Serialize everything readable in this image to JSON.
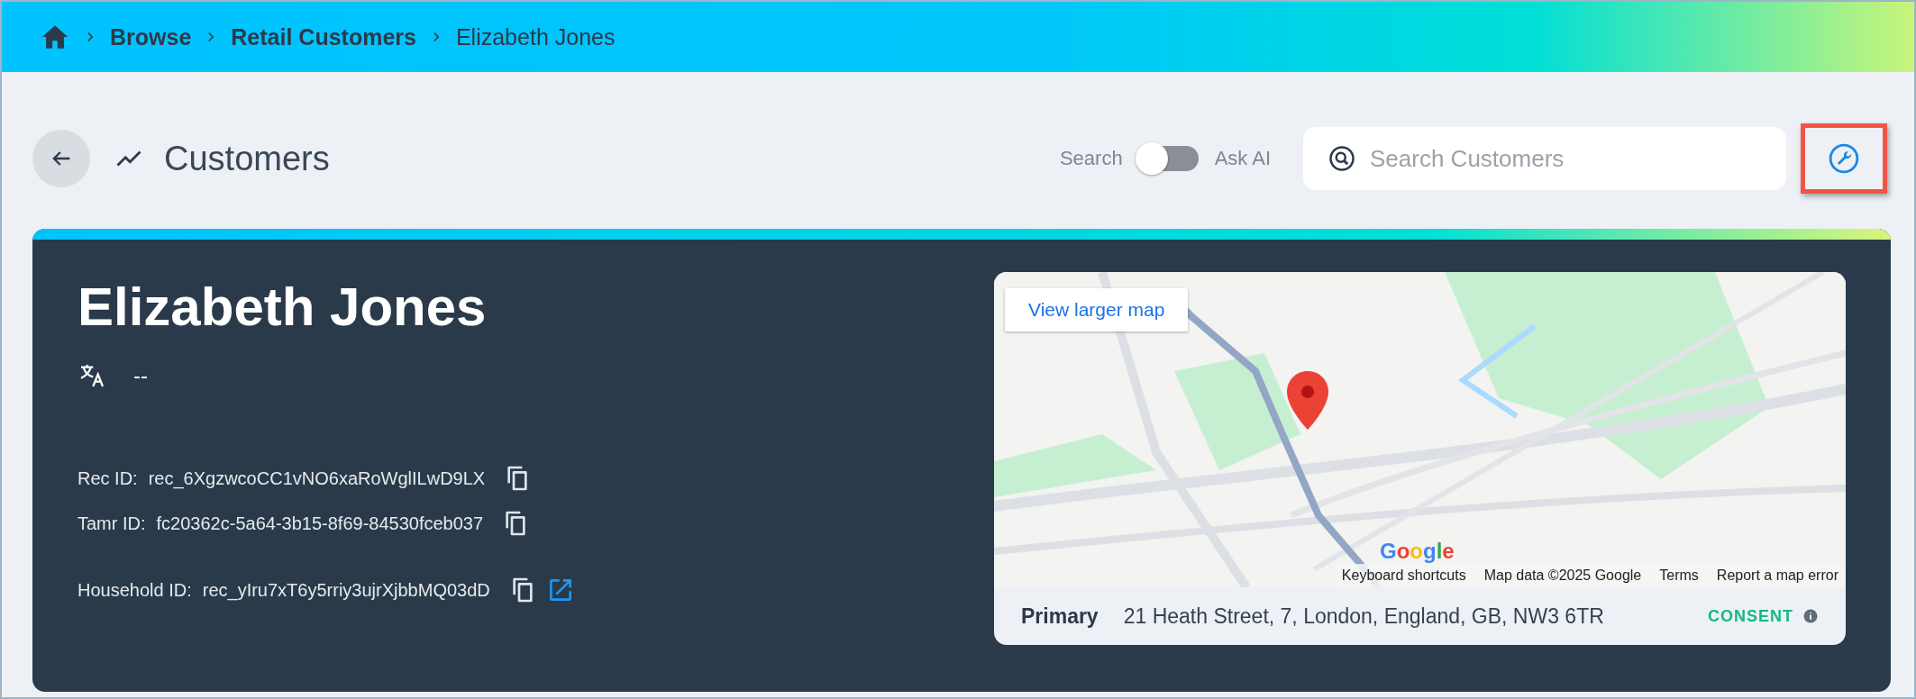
{
  "breadcrumb": [
    {
      "label": "Browse",
      "kind": "link"
    },
    {
      "label": "Retail Customers",
      "kind": "link"
    },
    {
      "label": "Elizabeth Jones",
      "kind": "current"
    }
  ],
  "header": {
    "title": "Customers",
    "mode_toggle": {
      "left_label": "Search",
      "right_label": "Ask AI",
      "on": false
    },
    "search": {
      "placeholder": "Search Customers"
    },
    "settings_button": {
      "highlighted": true
    }
  },
  "customer": {
    "name": "Elizabeth Jones",
    "language": "--",
    "id_groups": [
      [
        {
          "label": "Rec ID:",
          "value": "rec_6XgzwcoCC1vNO6xaRoWglILwD9LX",
          "open_link": false
        },
        {
          "label": "Tamr ID:",
          "value": "fc20362c-5a64-3b15-8f69-84530fceb037",
          "open_link": false
        }
      ],
      [
        {
          "label": "Household ID:",
          "value": "rec_yIru7xT6y5rriy3ujrXjbbMQ03dD",
          "open_link": true
        }
      ]
    ]
  },
  "map": {
    "view_larger": "View larger map",
    "logo": "Google",
    "attribution": [
      "Keyboard shortcuts",
      "Map data ©2025 Google",
      "Terms",
      "Report a map error"
    ],
    "address": {
      "type": "Primary",
      "text": "21 Heath Street, 7, London, England, GB, NW3 6TR",
      "consent": "CONSENT"
    }
  }
}
